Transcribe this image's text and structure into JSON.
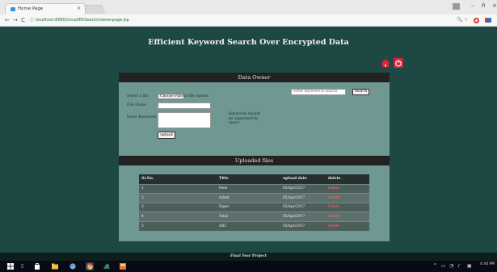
{
  "browser": {
    "tab_title": "Home Page",
    "tab_close": "×",
    "url": "localhost:8080/cloud/EKSearch/ownerpage.jsp",
    "nav": {
      "back": "←",
      "forward": "→",
      "reload": "C"
    }
  },
  "window_controls": {
    "minimize": "–",
    "maximize": "ñ",
    "close": "×"
  },
  "page": {
    "title": "Efficient Keyword Search Over Encrypted Data",
    "colors": {
      "background": "#1e4844",
      "panel": "#6f9892",
      "header": "#222222",
      "delete": "#ff6b6b"
    }
  },
  "owner_panel": {
    "heading": "Data Owner",
    "select_file_label": "Select a file",
    "choose_file_button": "Choose File",
    "no_file_text": "No file chosen",
    "file_name_label": "File Name",
    "keyword_label": "Enter Keywords",
    "keyword_note": "Keywords should be separated by space",
    "upload_button": "upload",
    "search_placeholder": "Enter Keyword to search",
    "search_button": "Search"
  },
  "uploaded_panel": {
    "heading": "Uploaded files",
    "columns": [
      "Sr.No.",
      "Title",
      "upload date",
      "delete"
    ],
    "rows": [
      {
        "sr": "1",
        "title": "Fees",
        "date": "05/Apr/2017",
        "action": "Delete"
      },
      {
        "sr": "2",
        "title": "Admit",
        "date": "05/Apr/2017",
        "action": "Delete"
      },
      {
        "sr": "3",
        "title": "Paper",
        "date": "05/Apr/2017",
        "action": "Delete"
      },
      {
        "sr": "4",
        "title": "Total",
        "date": "05/Apr/2017",
        "action": "Delete"
      },
      {
        "sr": "5",
        "title": "ABC",
        "date": "05/Apr/2017",
        "action": "Delete"
      }
    ]
  },
  "footer": {
    "text": "Final Year Project"
  },
  "taskbar": {
    "clock": "4:40 PM"
  },
  "icons": [
    "home-icon",
    "power-icon",
    "start-icon",
    "search-icon",
    "folder-icon",
    "chrome-icon"
  ]
}
